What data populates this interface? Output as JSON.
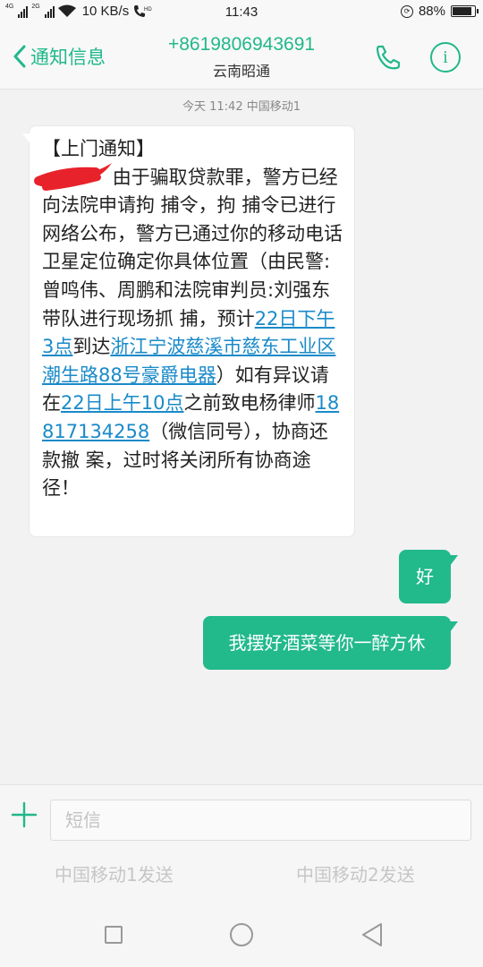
{
  "status_bar": {
    "net1": "4G",
    "net2": "2G",
    "speed": "10 KB/s",
    "hd": "HD",
    "time": "11:43",
    "battery": "88%",
    "battery_level": 0.88
  },
  "header": {
    "back_label": "通知信息",
    "contact_number": "+8619806943691",
    "contact_location": "云南昭通"
  },
  "thread": {
    "timestamp": "今天 11:42  中国移动1",
    "incoming": {
      "title": "【上门通知】",
      "p1": "由于骗取贷款罪，警方已经向法院申请拘 捕令，拘 捕令已进行网络公布，警方已通过你的移动电话卫星定位确定你具体位置（由民警:曾鸣伟、周鹏和法院审判员:刘强东带队进行现场抓 捕，预计",
      "link_time1": "22日下午3点",
      "p2": "到达",
      "link_address": "浙江宁波慈溪市慈东工业区潮生路88号豪爵电器",
      "p3": "）如有异议请在",
      "link_time2": "22日上午10点",
      "p4": "之前致电杨律师",
      "link_phone": "18817134258",
      "p5": "（微信同号），协商还款撤 案，过时将关闭所有协商途径！"
    },
    "outgoing": [
      "好",
      "我摆好酒菜等你一醉方休"
    ]
  },
  "compose": {
    "placeholder": "短信",
    "send_sim1": "中国移动1发送",
    "send_sim2": "中国移动2发送"
  },
  "colors": {
    "accent": "#21b88a",
    "outgoing_bubble": "#22b98b",
    "link": "#1a8ac9"
  }
}
